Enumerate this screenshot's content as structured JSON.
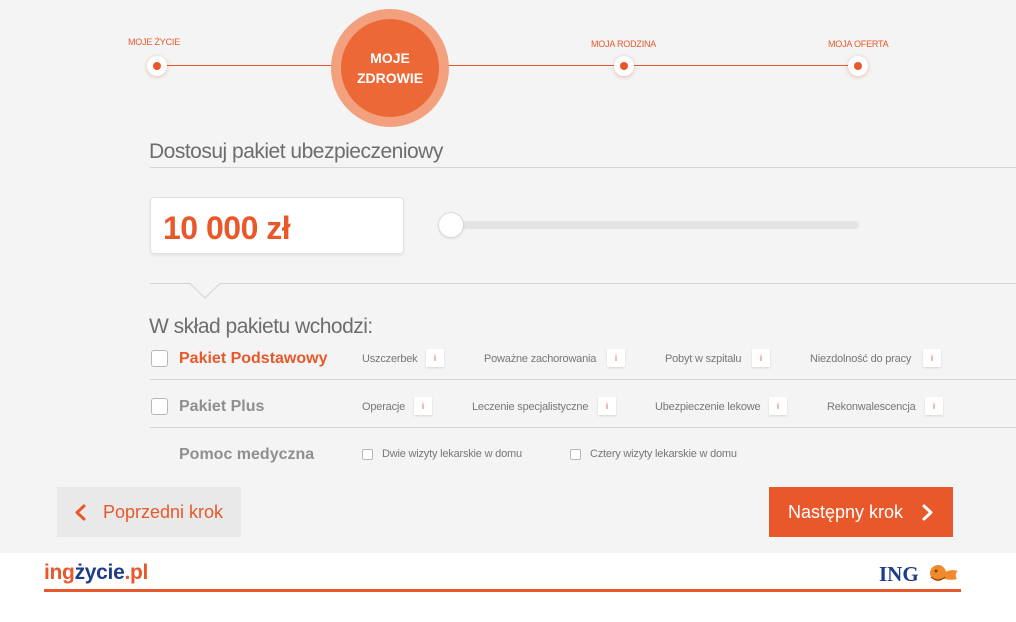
{
  "steps": [
    {
      "label": "MOJE ŻYCIE"
    },
    {
      "label_line1": "MOJE",
      "label_line2": "ZDROWIE"
    },
    {
      "label": "MOJA RODZINA"
    },
    {
      "label": "MOJA OFERTA"
    }
  ],
  "heading": "Dostosuj pakiet ubezpieczeniowy",
  "amount": "10 000 zł",
  "slider_value": 0.0,
  "subheading": "W skład pakietu wchodzi:",
  "packages": [
    {
      "name": "Pakiet Podstawowy",
      "features": [
        "Uszczerbek",
        "Poważne zachorowania",
        "Pobyt w szpitalu",
        "Niezdolność do pracy"
      ]
    },
    {
      "name": "Pakiet Plus",
      "features": [
        "Operacje",
        "Leczenie specjalistyczne",
        "Ubezpieczenie lekowe",
        "Rekonwalescencja"
      ]
    },
    {
      "name": "Pomoc medyczna",
      "options": [
        "Dwie wizyty lekarskie w domu",
        "Cztery wizyty lekarskie w domu"
      ]
    }
  ],
  "info_glyph": "i",
  "buttons": {
    "prev": "Poprzedni krok",
    "next": "Następny krok"
  },
  "footer": {
    "logo_prefix": "ing",
    "logo_mid": "życie",
    "logo_suffix": ".pl",
    "brand": "ING"
  },
  "colors": {
    "accent": "#e8582a",
    "accent_light": "#f3a07f",
    "logo_blue": "#1f3c88",
    "panel_bg": "#f4f4f4"
  }
}
